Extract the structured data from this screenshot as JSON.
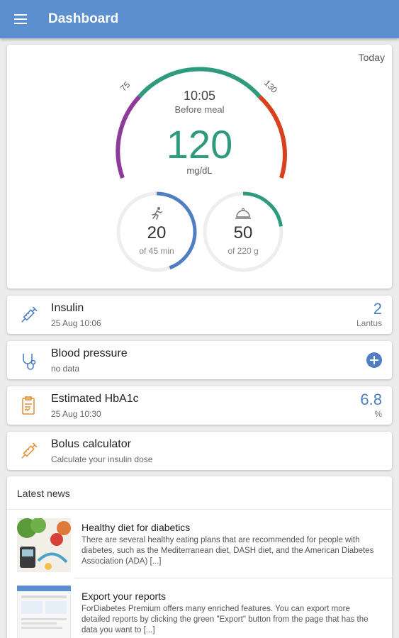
{
  "appbar": {
    "title": "Dashboard",
    "menu_icon": "hamburger-menu-icon"
  },
  "summary": {
    "period": "Today",
    "time": "10:05",
    "meal_context": "Before meal",
    "glucose_value": "120",
    "glucose_unit": "mg/dL",
    "target_low": "75",
    "target_high": "130",
    "colors": {
      "in_range": "#2e9b7c",
      "low": "#8e3a9b",
      "high": "#d9411e",
      "accent": "#4f7fc2",
      "track": "#eeeeee"
    },
    "activity": {
      "icon": "running-person-icon",
      "value": "20",
      "label": "of 45 min",
      "progress": 0.444
    },
    "carbs": {
      "icon": "food-cloche-icon",
      "value": "50",
      "label": "of 220 g",
      "progress": 0.227
    }
  },
  "insulin": {
    "icon": "syringe-icon",
    "title": "Insulin",
    "subtitle": "25 Aug 10:06",
    "value": "2",
    "unit": "Lantus"
  },
  "blood_pressure": {
    "icon": "stethoscope-icon",
    "title": "Blood pressure",
    "subtitle": "no data",
    "action_icon": "add-circle-icon"
  },
  "hba1c": {
    "icon": "lab-report-icon",
    "title": "Estimated HbA1c",
    "subtitle": "25 Aug 10:30",
    "value": "6.8",
    "unit": "%"
  },
  "bolus": {
    "icon": "syringe-icon",
    "title": "Bolus calculator",
    "subtitle": "Calculate your insulin dose"
  },
  "news": {
    "heading": "Latest news",
    "items": [
      {
        "title": "Healthy diet for diabetics",
        "body": "There are several healthy eating plans that are recommended for people with diabetes, such as the Mediterranean diet, DASH diet, and the American Diabetes Association (ADA) [...]"
      },
      {
        "title": "Export your reports",
        "body": "ForDiabetes Premium offers many enriched features. You can export more detailed reports by clicking the green \"Export\" button from the page that has the data you want to [...]"
      }
    ]
  }
}
